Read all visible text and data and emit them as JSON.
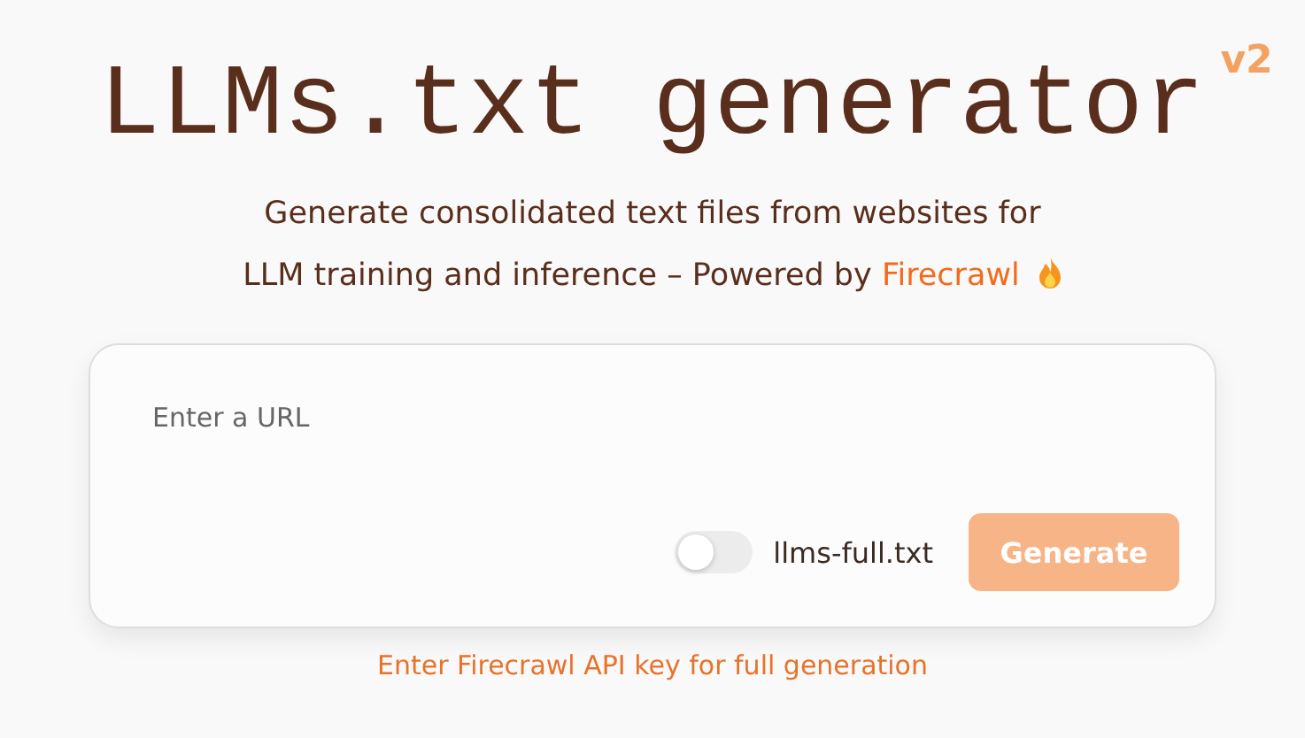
{
  "title": "LLMs.txt generator",
  "version_badge": "v2",
  "subtitle": {
    "line_1": "Generate consolidated text files from websites for",
    "line_2": "LLM training and inference – Powered by",
    "link": "Firecrawl"
  },
  "url_field": {
    "placeholder": "Enter a URL"
  },
  "full_toggle": {
    "label": "llms-full.txt",
    "on": false
  },
  "generate_button": {
    "label": "Generate",
    "disabled": true
  },
  "api_key_link": "Enter Firecrawl API key for full generation"
}
